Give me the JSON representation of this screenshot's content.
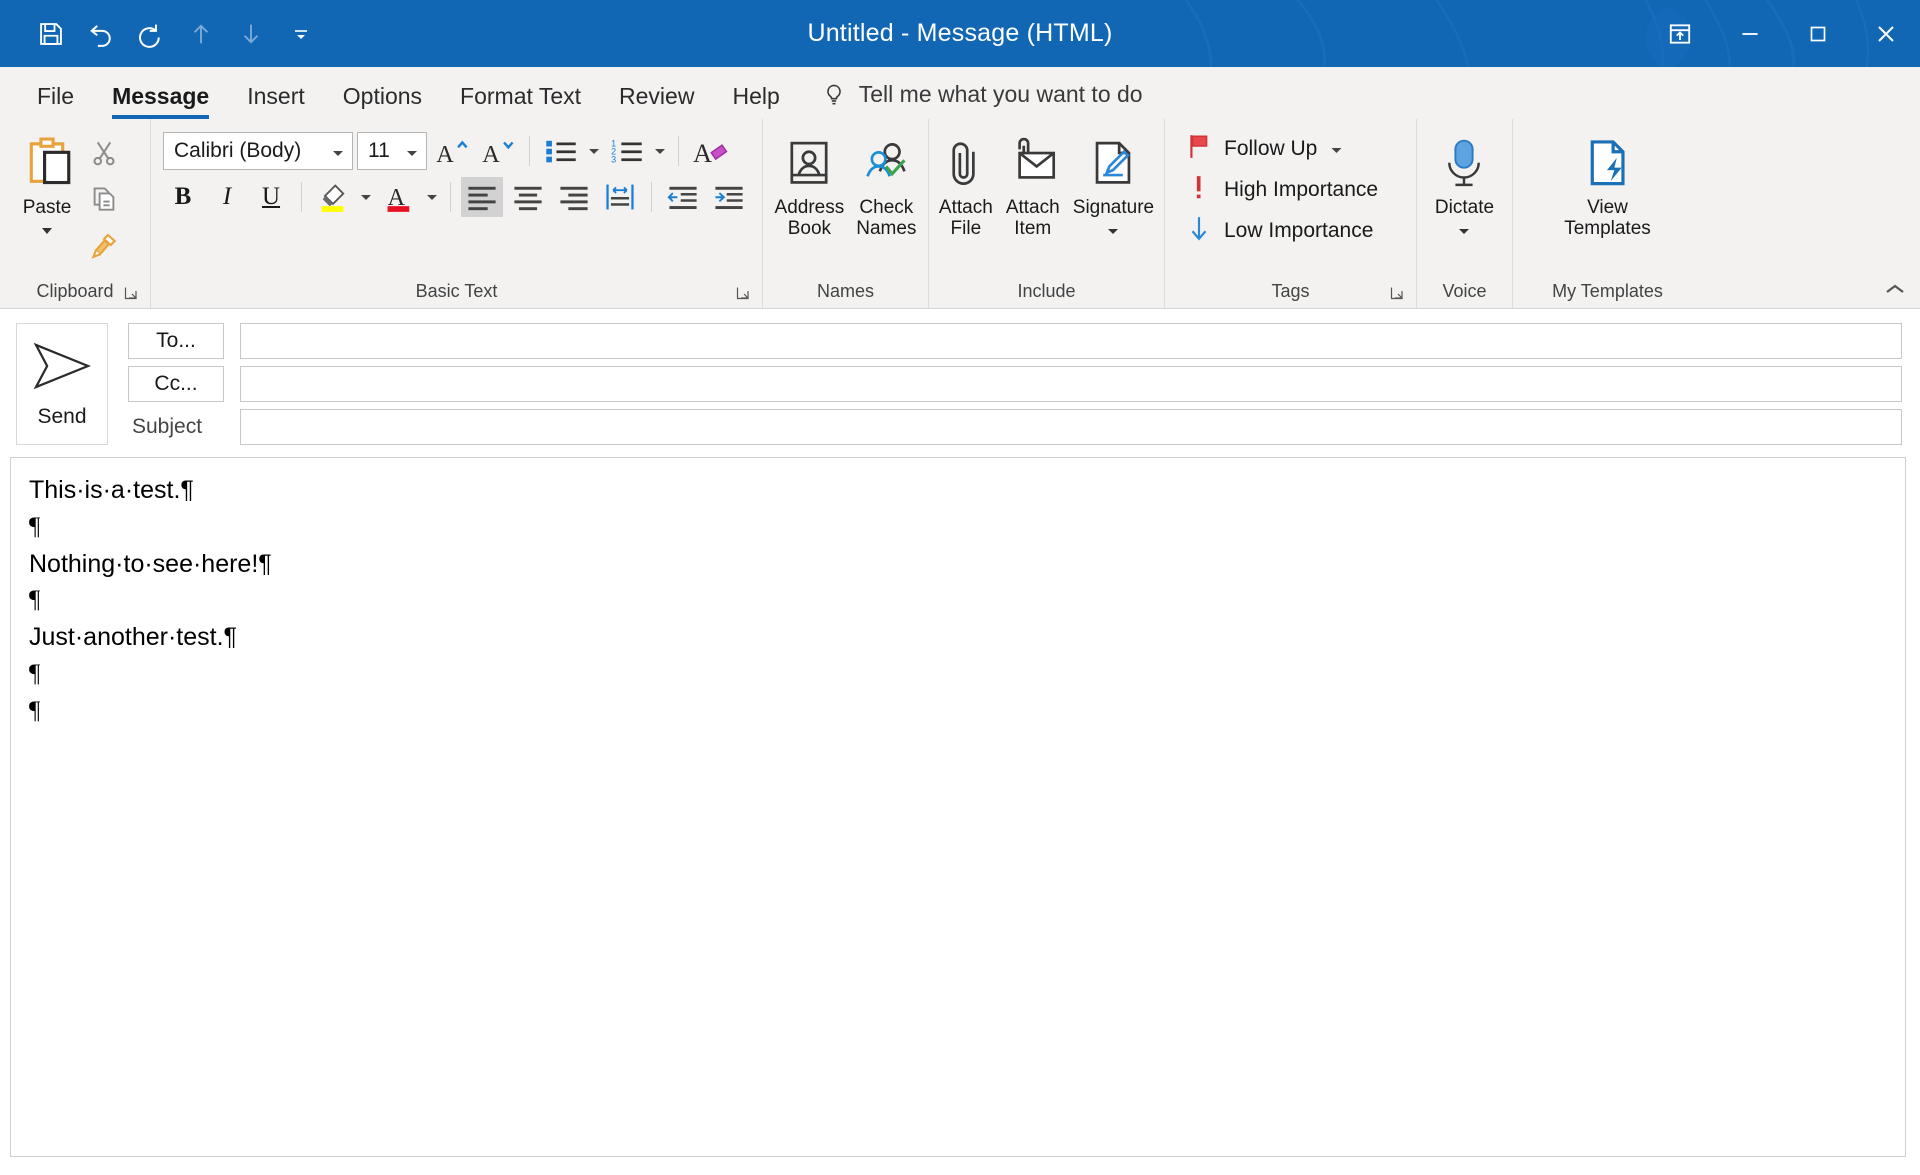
{
  "window": {
    "title": "Untitled  -  Message (HTML)",
    "accent_color": "#1267b5",
    "ribbon_bg": "#f3f2f1"
  },
  "quick_access": {
    "items": [
      {
        "name": "save-icon",
        "label": "Save",
        "dimmed": false
      },
      {
        "name": "undo-icon",
        "label": "Undo",
        "dimmed": false
      },
      {
        "name": "redo-icon",
        "label": "Redo",
        "dimmed": false
      },
      {
        "name": "previous-item-icon",
        "label": "Previous Item",
        "dimmed": true
      },
      {
        "name": "next-item-icon",
        "label": "Next Item",
        "dimmed": true
      },
      {
        "name": "customize-quick-access-toolbar-icon",
        "label": "Customize Quick Access Toolbar",
        "dimmed": false
      }
    ]
  },
  "window_controls": {
    "ribbon_display_options": "Ribbon Display Options",
    "minimize": "Minimize",
    "maximize": "Maximize",
    "close": "Close"
  },
  "tabs": [
    {
      "label": "File",
      "active": false
    },
    {
      "label": "Message",
      "active": true
    },
    {
      "label": "Insert",
      "active": false
    },
    {
      "label": "Options",
      "active": false
    },
    {
      "label": "Format Text",
      "active": false
    },
    {
      "label": "Review",
      "active": false
    },
    {
      "label": "Help",
      "active": false
    }
  ],
  "tell_me": {
    "placeholder": "Tell me what you want to do",
    "icon": "lightbulb-icon"
  },
  "ribbon": {
    "collapse_label": "Collapse the Ribbon",
    "groups": {
      "clipboard": {
        "label": "Clipboard",
        "paste": "Paste",
        "cut": "Cut",
        "copy": "Copy",
        "format_painter": "Format Painter",
        "dialog_launcher": "Clipboard settings"
      },
      "basic_text": {
        "label": "Basic Text",
        "font_name": "Calibri (Body)",
        "font_size": "11",
        "grow_font": "Increase Font Size",
        "shrink_font": "Decrease Font Size",
        "bullets": "Bullets",
        "numbering": "Numbering",
        "clear_formatting": "Clear All Formatting",
        "bold": "B",
        "italic": "I",
        "underline": "U",
        "highlight": "Text Highlight Color",
        "highlight_color": "#ffff00",
        "font_color": "Font Color",
        "font_color_value": "#e81123",
        "align_left": "Align Left",
        "align_center": "Center",
        "align_right": "Align Right",
        "justify": "Justify",
        "decrease_indent": "Decrease Indent",
        "increase_indent": "Increase Indent",
        "dialog_launcher": "Font settings"
      },
      "names": {
        "label": "Names",
        "address_book": "Address\nBook",
        "check_names": "Check\nNames"
      },
      "include": {
        "label": "Include",
        "attach_file": "Attach\nFile",
        "attach_item": "Attach\nItem",
        "signature": "Signature"
      },
      "tags": {
        "label": "Tags",
        "follow_up": "Follow Up",
        "high_importance": "High Importance",
        "low_importance": "Low Importance",
        "dialog_launcher": "Properties",
        "flag_color": "#e8484a",
        "high_color": "#d13438",
        "low_color": "#2b88d8"
      },
      "voice": {
        "label": "Voice",
        "dictate": "Dictate",
        "mic_color": "#5ca3e0"
      },
      "my_templates": {
        "label": "My Templates",
        "view_templates": "View\nTemplates",
        "icon_color": "#1a6fb5"
      }
    }
  },
  "compose": {
    "send_button": "Send",
    "to_button": "To...",
    "cc_button": "Cc...",
    "subject_label": "Subject",
    "to_value": "",
    "cc_value": "",
    "subject_value": ""
  },
  "message_body": {
    "lines": [
      "This·is·a·test.¶",
      "¶",
      "Nothing·to·see·here!¶",
      "¶",
      "Just·another·test.¶",
      "¶",
      "¶"
    ]
  }
}
